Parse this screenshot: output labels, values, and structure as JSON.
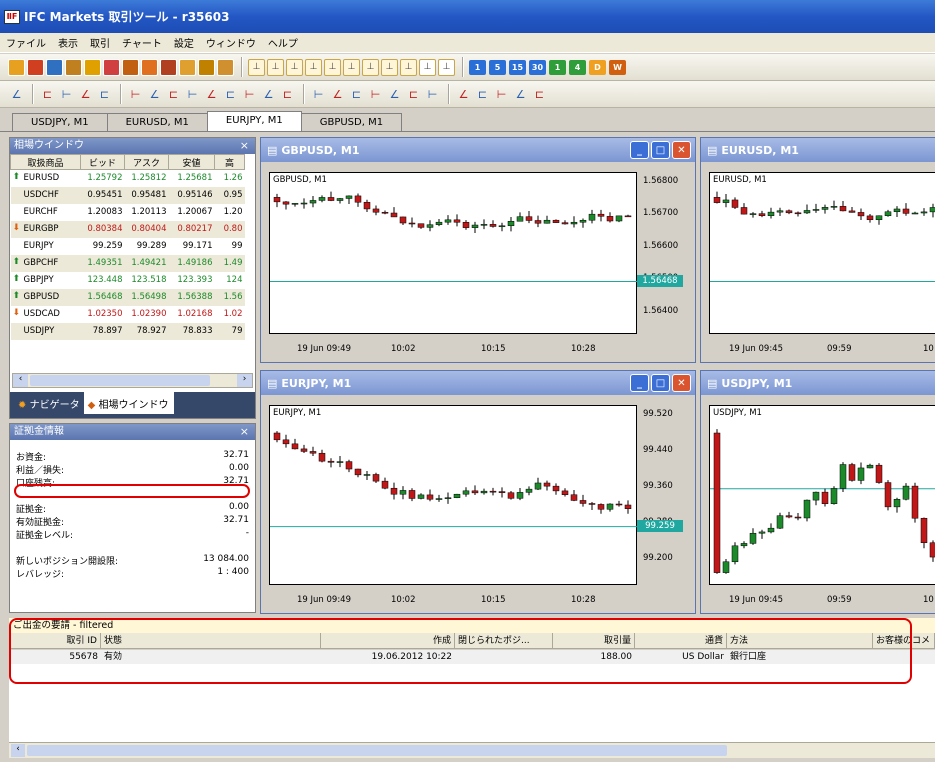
{
  "window": {
    "title": "IFC Markets 取引ツール - r35603",
    "icon": "app-icon"
  },
  "menu": [
    "ファイル",
    "表示",
    "取引",
    "チャート",
    "設定",
    "ウィンドウ",
    "ヘルプ"
  ],
  "timeframes": [
    {
      "label": "1",
      "color": "#2a6fd8"
    },
    {
      "label": "5",
      "color": "#2a6fd8"
    },
    {
      "label": "15",
      "color": "#2a6fd8"
    },
    {
      "label": "30",
      "color": "#2a6fd8"
    },
    {
      "label": "1",
      "color": "#2f9d3a"
    },
    {
      "label": "4",
      "color": "#2f9d3a"
    },
    {
      "label": "D",
      "color": "#f0a020"
    },
    {
      "label": "W",
      "color": "#d06010"
    }
  ],
  "chart_tabs": [
    "USDJPY, M1",
    "EURUSD, M1",
    "EURJPY, M1",
    "GBPUSD, M1"
  ],
  "active_tab": 2,
  "market_watch": {
    "title": "相場ウインドウ",
    "columns": [
      "取扱商品",
      "ビッド",
      "アスク",
      "安値",
      "高"
    ],
    "rows": [
      {
        "symbol": "EURUSD",
        "bid": "1.25792",
        "ask": "1.25812",
        "low": "1.25681",
        "high": "1.26",
        "dir": "up"
      },
      {
        "symbol": "USDCHF",
        "bid": "0.95451",
        "ask": "0.95481",
        "low": "0.95146",
        "high": "0.95",
        "dir": "none"
      },
      {
        "symbol": "EURCHF",
        "bid": "1.20083",
        "ask": "1.20113",
        "low": "1.20067",
        "high": "1.20",
        "dir": "none"
      },
      {
        "symbol": "EURGBP",
        "bid": "0.80384",
        "ask": "0.80404",
        "low": "0.80217",
        "high": "0.80",
        "dir": "down"
      },
      {
        "symbol": "EURJPY",
        "bid": "99.259",
        "ask": "99.289",
        "low": "99.171",
        "high": "99",
        "dir": "none"
      },
      {
        "symbol": "GBPCHF",
        "bid": "1.49351",
        "ask": "1.49421",
        "low": "1.49186",
        "high": "1.49",
        "dir": "up"
      },
      {
        "symbol": "GBPJPY",
        "bid": "123.448",
        "ask": "123.518",
        "low": "123.393",
        "high": "124",
        "dir": "up"
      },
      {
        "symbol": "GBPUSD",
        "bid": "1.56468",
        "ask": "1.56498",
        "low": "1.56388",
        "high": "1.56",
        "dir": "up"
      },
      {
        "symbol": "USDCAD",
        "bid": "1.02350",
        "ask": "1.02390",
        "low": "1.02168",
        "high": "1.02",
        "dir": "down"
      },
      {
        "symbol": "USDJPY",
        "bid": "78.897",
        "ask": "78.927",
        "low": "78.833",
        "high": "79",
        "dir": "none"
      }
    ],
    "tab_nav": "ナビゲータ",
    "tab_mw": "相場ウインドウ"
  },
  "funds": {
    "title": "証拠金情報",
    "rows": [
      {
        "label": "お資金:",
        "value": "32.71"
      },
      {
        "label": "利益／損失:",
        "value": "0.00"
      },
      {
        "label": "口座残高:",
        "value": "32.71"
      },
      {
        "label": "",
        "value": ""
      },
      {
        "label": "証拠金:",
        "value": "0.00"
      },
      {
        "label": "有効証拠金:",
        "value": "32.71"
      },
      {
        "label": "証拠金レベル:",
        "value": "-"
      },
      {
        "label": "",
        "value": ""
      },
      {
        "label": "新しいポジション開設限:",
        "value": "13 084.00"
      },
      {
        "label": "レバレッジ:",
        "value": "1 : 400"
      }
    ]
  },
  "colors": {
    "bull": "#1c8a2a",
    "bear": "#c01818",
    "level": "#20a8a0",
    "highlight": "#e00000"
  },
  "charts": [
    {
      "id": "gbpusd",
      "window_title": "GBPUSD, M1",
      "inner_title": "GBPUSD, M1",
      "price_tag": "1.56468",
      "y_ticks": [
        "1.56800",
        "1.56700",
        "1.56600",
        "1.56500",
        "1.56400"
      ],
      "x_ticks": [
        "19 Jun 09:49",
        "10:02",
        "10:15",
        "10:28"
      ]
    },
    {
      "id": "eurusd",
      "window_title": "EURUSD, M1",
      "inner_title": "EURUSD, M1",
      "price_tag": "",
      "y_ticks": [],
      "x_ticks": [
        "19 Jun 09:45",
        "09:59",
        "10"
      ]
    },
    {
      "id": "eurjpy",
      "window_title": "EURJPY, M1",
      "inner_title": "EURJPY, M1",
      "price_tag": "99.259",
      "y_ticks": [
        "99.520",
        "99.440",
        "99.360",
        "99.280",
        "99.200"
      ],
      "x_ticks": [
        "19 Jun 09:49",
        "10:02",
        "10:15",
        "10:28"
      ]
    },
    {
      "id": "usdjpy",
      "window_title": "USDJPY, M1",
      "inner_title": "USDJPY, M1",
      "price_tag": "",
      "y_ticks": [],
      "x_ticks": [
        "19 Jun 09:45",
        "09:59",
        "10"
      ]
    }
  ],
  "requests": {
    "title": "ご出金の要請 - filtered",
    "columns": [
      "取引 ID",
      "状態",
      "作成",
      "閉じられたポジ...",
      "取引量",
      "通貨",
      "方法",
      "お客様のコメ"
    ],
    "rows": [
      {
        "id": "55678",
        "status": "有効",
        "created": "19.06.2012 10:22",
        "closed": "",
        "volume": "188.00",
        "currency": "US Dollar",
        "method": "銀行口座",
        "comment": ""
      }
    ]
  }
}
